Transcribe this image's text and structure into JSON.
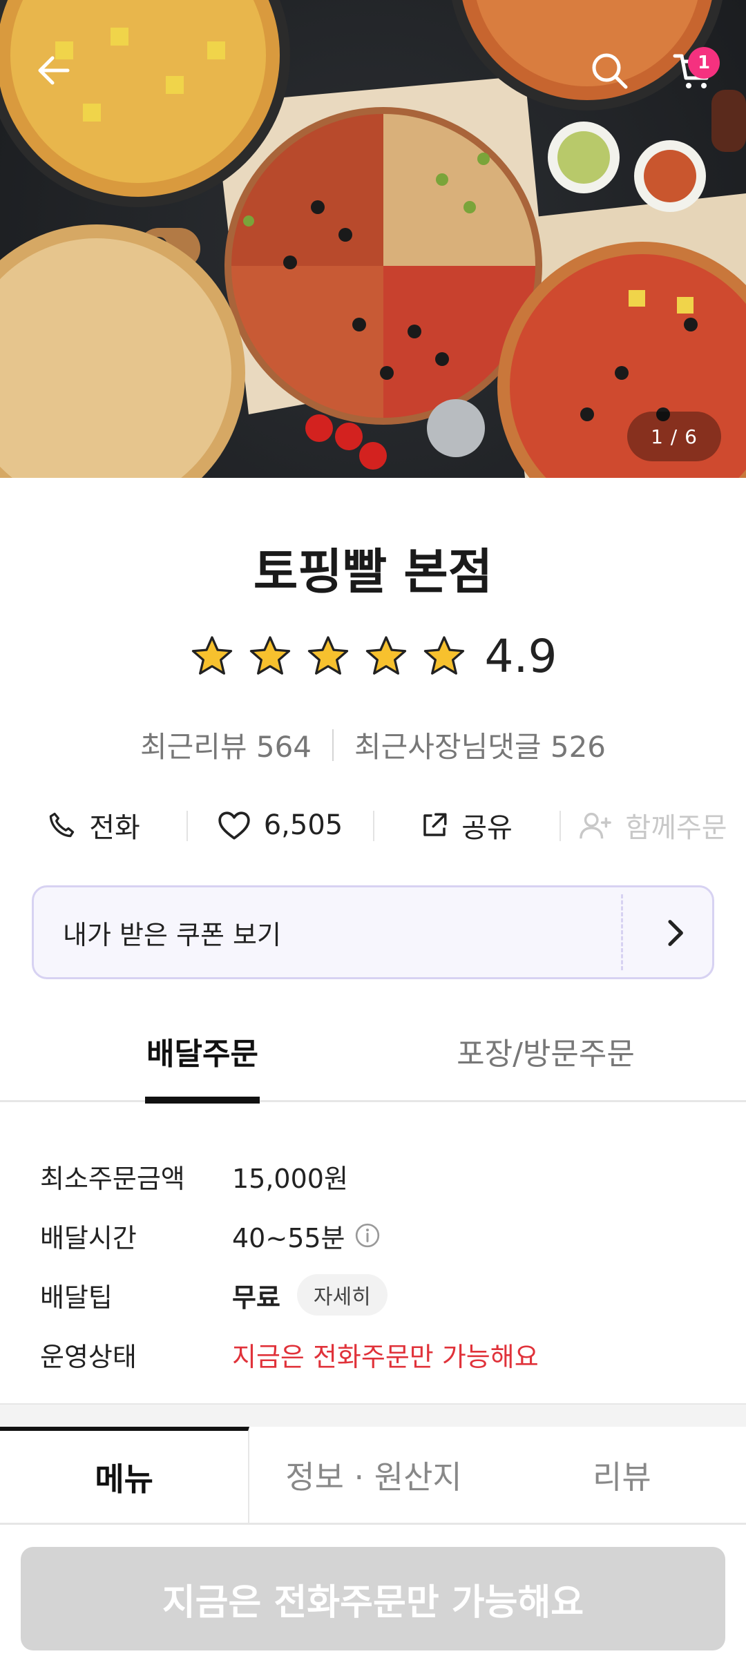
{
  "hero": {
    "photo_counter": "1 / 6",
    "cart_count": "1",
    "icons": {
      "back": "arrow-left-icon",
      "search": "search-icon",
      "cart": "cart-icon"
    }
  },
  "store": {
    "name": "토핑빨 본점",
    "rating": "4.9",
    "rating_stars": 5,
    "recent_reviews": "최근리뷰 564",
    "owner_replies": "최근사장님댓글 526"
  },
  "actions": {
    "call": "전화",
    "likes": "6,505",
    "share": "공유",
    "group_order": "함께주문"
  },
  "coupon": {
    "label": "내가 받은 쿠폰 보기"
  },
  "order_tabs": {
    "delivery": "배달주문",
    "pickup": "포장/방문주문"
  },
  "delivery_info": {
    "min_order_label": "최소주문금액",
    "min_order_value": "15,000원",
    "delivery_time_label": "배달시간",
    "delivery_time_value": "40~55분",
    "delivery_tip_label": "배달팁",
    "delivery_tip_value": "무료",
    "detail_chip": "자세히",
    "status_label": "운영상태",
    "status_value": "지금은 전화주문만 가능해요"
  },
  "menu_tabs": {
    "menu": "메뉴",
    "info": "정보 · 원산지",
    "reviews": "리뷰"
  },
  "cta": {
    "label": "지금은 전화주문만 가능해요"
  },
  "colors": {
    "badge": "#f5317f",
    "warning": "#e0323a",
    "star": "#f7c12e",
    "coupon_border": "#d7d2f2",
    "cta_disabled": "#d4d4d4"
  }
}
